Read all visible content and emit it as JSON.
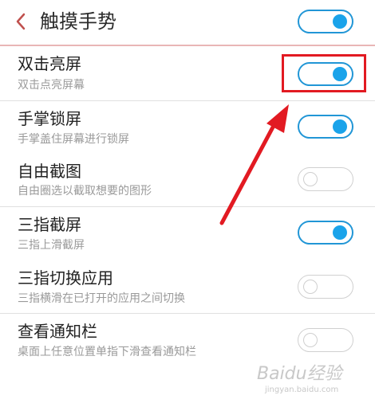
{
  "header": {
    "title": "触摸手势",
    "toggle_on": true
  },
  "items": [
    {
      "title": "双击亮屏",
      "subtitle": "双击点亮屏幕",
      "enabled": true
    },
    {
      "title": "手掌锁屏",
      "subtitle": "手掌盖住屏幕进行锁屏",
      "enabled": true
    },
    {
      "title": "自由截图",
      "subtitle": "自由圈选以截取想要的图形",
      "enabled": false
    },
    {
      "title": "三指截屏",
      "subtitle": "三指上滑截屏",
      "enabled": true
    },
    {
      "title": "三指切换应用",
      "subtitle": "三指横滑在已打开的应用之间切换",
      "enabled": false
    },
    {
      "title": "查看通知栏",
      "subtitle": "桌面上任意位置单指下滑查看通知栏",
      "enabled": false
    }
  ],
  "colors": {
    "toggle_on": "#1aa3ea",
    "toggle_border_on": "#2196d6",
    "highlight": "#e21a22",
    "back_icon": "#c0504d"
  },
  "watermark": {
    "text": "Baidu经验",
    "url": "jingyan.baidu.com"
  }
}
